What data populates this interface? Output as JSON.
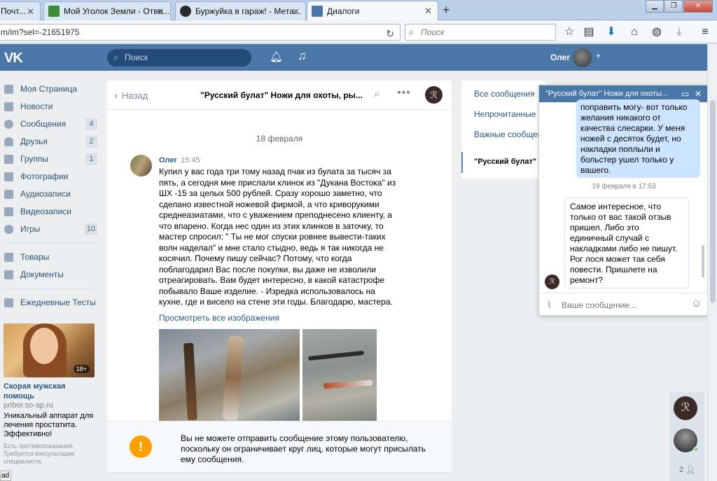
{
  "browser": {
    "tabs": [
      {
        "label": "Почт...",
        "fav_color": "#d44a2e"
      },
      {
        "label": "Мой Уголок Земли - Отве...",
        "fav_color": "#3a8b3a"
      },
      {
        "label": "Буржуйка в гараж! - Мета...",
        "fav_color": "#2a2a2a"
      },
      {
        "label": "Диалоги",
        "fav_color": "#4a76a8"
      }
    ],
    "url": "m/im?sel=-21651975",
    "search_placeholder": "Поиск"
  },
  "vk": {
    "logo": "VK",
    "search_placeholder": "Поиск",
    "user_name": "Олег"
  },
  "left_menu": {
    "items": [
      {
        "label": "Моя Страница",
        "count": ""
      },
      {
        "label": "Новости",
        "count": ""
      },
      {
        "label": "Сообщения",
        "count": "4"
      },
      {
        "label": "Друзья",
        "count": "2"
      },
      {
        "label": "Группы",
        "count": "1"
      },
      {
        "label": "Фотографии",
        "count": ""
      },
      {
        "label": "Аудиозаписи",
        "count": ""
      },
      {
        "label": "Видеозаписи",
        "count": ""
      },
      {
        "label": "Игры",
        "count": "10"
      }
    ],
    "items2": [
      {
        "label": "Товары"
      },
      {
        "label": "Документы"
      }
    ],
    "items3": [
      {
        "label": "Ежедневные Тесты"
      }
    ],
    "ad": {
      "badge": "18+",
      "title": "Скорая мужская помощь",
      "domain": "pribor.so-ap.ru",
      "text": "Уникальный аппарат для лечения простатита. Эффективно!",
      "disclaimer": "Есть противопоказания. Требуется консультация специалиста."
    }
  },
  "dialog": {
    "back_label": "Назад",
    "title": "\"Русский булат\" Ножи для охоты, ры...",
    "date": "18 февраля",
    "message": {
      "author": "Олег",
      "time": "15:45",
      "text": "Купил у вас года три тому назад пчак из булата за тысяч за пять, а сегодня мне прислали клинок из \"Дукана Востока\" из ШХ -15 за целых 500 рублей. Сразу хорошо заметно, что сделано известной ножевой фирмой, а что криворукими среднеазиатами, что с уважением преподнесено клиенту, а что впарено. Когда нес один из этих клинков в заточку, то мастер спросил: \" Ты не мог спуски ровнее вывести-таких волн наделал\" и мне стало стыдно, ведь я так никогда не косячил. Почему пишу сейчас? Потому, что когда поблагодарил Вас после покупки, вы даже не изволили отреагировать. Вам будет интересно, в какой катастрофе побывало Ваше изделие. - Изредка использовалось на кухне, где и висело на стене эти годы. Благодарю, мастера.",
      "view_all": "Просмотреть все изображения"
    },
    "notice": "Вы не можете отправить сообщение этому пользователю, поскольку он ограничивает круг лиц, которые могут присылать ему сообщения."
  },
  "filters": {
    "all": "Все сообщения",
    "unread": "Непрочитанные",
    "important": "Важные сообщения",
    "conversation": "\"Русский булат\" Н"
  },
  "chat": {
    "title": "\"Русский булат\" Ножи для охоты...",
    "outgoing": "поправить могу- вот только желания никакого от качества слесарки. У меня ножей с десяток будет, но накладки поплыли и больстер ушел только у вашего.",
    "date": "19 февраля в 17:53",
    "incoming": "Самое интересное, что только от вас такой отзыв пришел. Либо это единичный случай с накладками либо не пишут. Рог лося может так себя повести. Пришлете на ремонт?",
    "input_placeholder": "Ваше сообщение..."
  },
  "sidebar_right": {
    "count": "2"
  },
  "status": {
    "text": "ad"
  }
}
